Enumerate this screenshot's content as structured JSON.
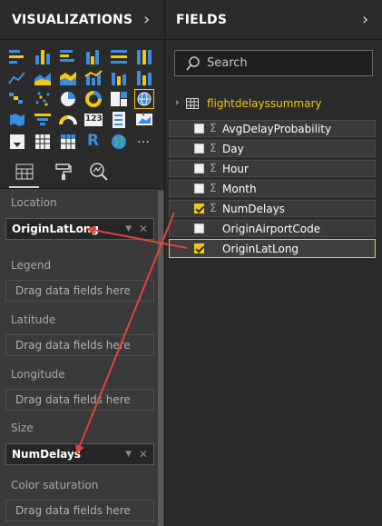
{
  "visualizations": {
    "title": "VISUALIZATIONS",
    "more_icon": "…",
    "r_label": "R",
    "table_num": "123",
    "wells": [
      {
        "label": "Location",
        "value": "OriginLatLong",
        "placeholder": ""
      },
      {
        "label": "Legend",
        "value": "",
        "placeholder": "Drag data fields here"
      },
      {
        "label": "Latitude",
        "value": "",
        "placeholder": "Drag data fields here"
      },
      {
        "label": "Longitude",
        "value": "",
        "placeholder": "Drag data fields here"
      },
      {
        "label": "Size",
        "value": "NumDelays",
        "placeholder": ""
      },
      {
        "label": "Color saturation",
        "value": "",
        "placeholder": "Drag data fields here"
      }
    ]
  },
  "fields": {
    "title": "FIELDS",
    "search_placeholder": "Search",
    "table_name": "flightdelayssummary",
    "items": [
      {
        "label": "AvgDelayProbability",
        "sigma": "Σ",
        "checked": false
      },
      {
        "label": "Day",
        "sigma": "Σ",
        "checked": false
      },
      {
        "label": "Hour",
        "sigma": "Σ",
        "checked": false
      },
      {
        "label": "Month",
        "sigma": "Σ",
        "checked": false
      },
      {
        "label": "NumDelays",
        "sigma": "Σ",
        "checked": true
      },
      {
        "label": "OriginAirportCode",
        "sigma": "",
        "checked": false
      },
      {
        "label": "OriginLatLong",
        "sigma": "",
        "checked": true
      }
    ]
  },
  "colors": {
    "accent": "#f2c811",
    "arrow": "#e0463c",
    "panel": "#2b2b2b"
  }
}
